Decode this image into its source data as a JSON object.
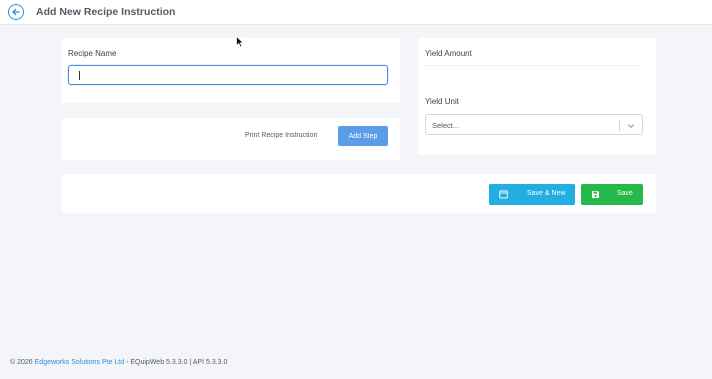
{
  "header": {
    "title": "Add New Recipe Instruction"
  },
  "form": {
    "recipe_name_label": "Recipe Name",
    "recipe_name_value": "",
    "yield_amount_label": "Yield Amount",
    "yield_unit_label": "Yield Unit",
    "yield_unit_selected": "Select..."
  },
  "actions": {
    "print_label": "Print Recipe Instruction",
    "add_step_label": "Add Step",
    "save_new_label": "Save & New",
    "save_label": "Save"
  },
  "footer": {
    "prefix": "© 2026",
    "company": "Edgeworks Solutions Pte Ltd",
    "suffix": "- EQuipWeb 5.3.3.0 | API 5.3.3.0"
  },
  "colors": {
    "accent": "#2f8fd8",
    "add_step": "#5b9ce8",
    "save_new": "#22aee0",
    "save": "#27b84b",
    "background": "#f3f5f9"
  },
  "icons": {
    "back": "arrow-left-circle-icon",
    "save_new": "window-icon",
    "save": "floppy-disk-icon",
    "dropdown": "chevron-down-icon"
  }
}
